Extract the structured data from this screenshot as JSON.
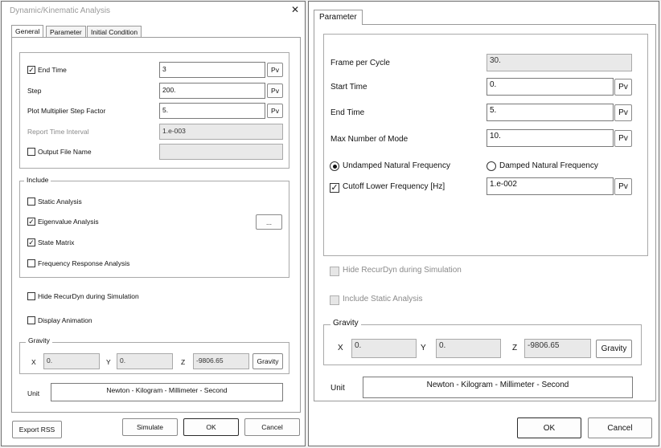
{
  "left": {
    "title": "Dynamic/Kinematic Analysis",
    "close_glyph": "✕",
    "tabs": [
      {
        "label": "General"
      },
      {
        "label": "Parameter"
      },
      {
        "label": "Initial Condition"
      }
    ],
    "end_time": {
      "label": "End Time",
      "value": "3",
      "checked": true,
      "pv": "Pv"
    },
    "step": {
      "label": "Step",
      "value": "200.",
      "pv": "Pv"
    },
    "plot_multiplier": {
      "label": "Plot Multiplier Step Factor",
      "value": "5.",
      "pv": "Pv"
    },
    "report_interval": {
      "label": "Report Time Interval",
      "value": "1.e-003"
    },
    "output_file": {
      "label": "Output File Name",
      "value": "",
      "checked": false
    },
    "include": {
      "legend": "Include",
      "static": {
        "label": "Static Analysis",
        "checked": false
      },
      "eigenvalue": {
        "label": "Eigenvalue Analysis",
        "checked": true
      },
      "state_matrix": {
        "label": "State Matrix",
        "checked": true
      },
      "freq_response": {
        "label": "Frequency Response Analysis",
        "checked": false
      },
      "more_button": "..."
    },
    "hide_recurdyn": {
      "label": "Hide RecurDyn during Simulation",
      "checked": false
    },
    "display_animation": {
      "label": "Display Animation",
      "checked": false
    },
    "gravity": {
      "legend": "Gravity",
      "x_label": "X",
      "x": "0.",
      "y_label": "Y",
      "y": "0.",
      "z_label": "Z",
      "z": "-9806.65",
      "button": "Gravity"
    },
    "unit": {
      "label": "Unit",
      "value": "Newton - Kilogram - Millimeter - Second"
    },
    "buttons": {
      "export": "Export RSS",
      "simulate": "Simulate",
      "ok": "OK",
      "cancel": "Cancel"
    }
  },
  "right": {
    "tab": "Parameter",
    "frame_per_cycle": {
      "label": "Frame per Cycle",
      "value": "30."
    },
    "start_time": {
      "label": "Start Time",
      "value": "0.",
      "pv": "Pv"
    },
    "end_time": {
      "label": "End Time",
      "value": "5.",
      "pv": "Pv"
    },
    "max_modes": {
      "label": "Max Number of Mode",
      "value": "10.",
      "pv": "Pv"
    },
    "undamped": {
      "label": "Undamped Natural Frequency",
      "selected": true
    },
    "damped": {
      "label": "Damped Natural Frequency",
      "selected": false
    },
    "cutoff": {
      "label": "Cutoff Lower Frequency [Hz]",
      "value": "1.e-002",
      "checked": true,
      "pv": "Pv"
    },
    "hide_recurdyn": {
      "label": "Hide RecurDyn during Simulation",
      "checked": false,
      "disabled": true
    },
    "include_static": {
      "label": "Include Static Analysis",
      "checked": false,
      "disabled": true
    },
    "gravity": {
      "legend": "Gravity",
      "x_label": "X",
      "x": "0.",
      "y_label": "Y",
      "y": "0.",
      "z_label": "Z",
      "z": "-9806.65",
      "button": "Gravity"
    },
    "unit": {
      "label": "Unit",
      "value": "Newton - Kilogram - Millimeter - Second"
    },
    "buttons": {
      "ok": "OK",
      "cancel": "Cancel"
    }
  },
  "check_glyph": "✓"
}
